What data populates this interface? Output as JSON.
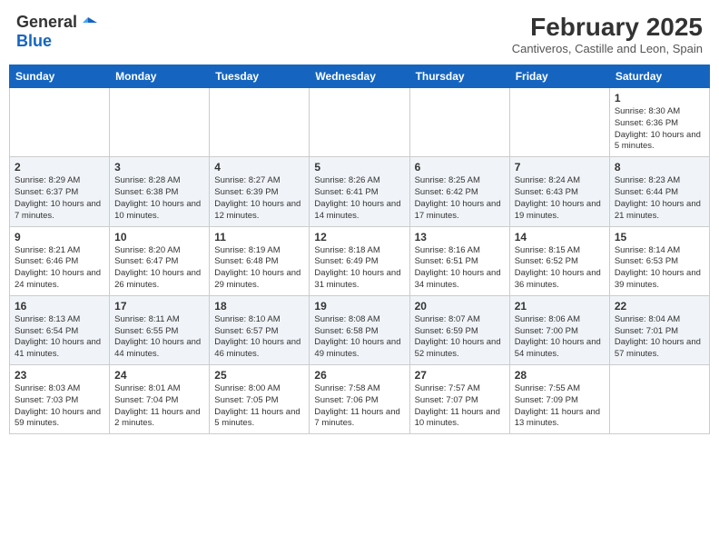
{
  "header": {
    "logo_general": "General",
    "logo_blue": "Blue",
    "month_title": "February 2025",
    "subtitle": "Cantiveros, Castille and Leon, Spain"
  },
  "columns": [
    "Sunday",
    "Monday",
    "Tuesday",
    "Wednesday",
    "Thursday",
    "Friday",
    "Saturday"
  ],
  "weeks": [
    [
      {
        "day": "",
        "info": ""
      },
      {
        "day": "",
        "info": ""
      },
      {
        "day": "",
        "info": ""
      },
      {
        "day": "",
        "info": ""
      },
      {
        "day": "",
        "info": ""
      },
      {
        "day": "",
        "info": ""
      },
      {
        "day": "1",
        "info": "Sunrise: 8:30 AM\nSunset: 6:36 PM\nDaylight: 10 hours and 5 minutes."
      }
    ],
    [
      {
        "day": "2",
        "info": "Sunrise: 8:29 AM\nSunset: 6:37 PM\nDaylight: 10 hours and 7 minutes."
      },
      {
        "day": "3",
        "info": "Sunrise: 8:28 AM\nSunset: 6:38 PM\nDaylight: 10 hours and 10 minutes."
      },
      {
        "day": "4",
        "info": "Sunrise: 8:27 AM\nSunset: 6:39 PM\nDaylight: 10 hours and 12 minutes."
      },
      {
        "day": "5",
        "info": "Sunrise: 8:26 AM\nSunset: 6:41 PM\nDaylight: 10 hours and 14 minutes."
      },
      {
        "day": "6",
        "info": "Sunrise: 8:25 AM\nSunset: 6:42 PM\nDaylight: 10 hours and 17 minutes."
      },
      {
        "day": "7",
        "info": "Sunrise: 8:24 AM\nSunset: 6:43 PM\nDaylight: 10 hours and 19 minutes."
      },
      {
        "day": "8",
        "info": "Sunrise: 8:23 AM\nSunset: 6:44 PM\nDaylight: 10 hours and 21 minutes."
      }
    ],
    [
      {
        "day": "9",
        "info": "Sunrise: 8:21 AM\nSunset: 6:46 PM\nDaylight: 10 hours and 24 minutes."
      },
      {
        "day": "10",
        "info": "Sunrise: 8:20 AM\nSunset: 6:47 PM\nDaylight: 10 hours and 26 minutes."
      },
      {
        "day": "11",
        "info": "Sunrise: 8:19 AM\nSunset: 6:48 PM\nDaylight: 10 hours and 29 minutes."
      },
      {
        "day": "12",
        "info": "Sunrise: 8:18 AM\nSunset: 6:49 PM\nDaylight: 10 hours and 31 minutes."
      },
      {
        "day": "13",
        "info": "Sunrise: 8:16 AM\nSunset: 6:51 PM\nDaylight: 10 hours and 34 minutes."
      },
      {
        "day": "14",
        "info": "Sunrise: 8:15 AM\nSunset: 6:52 PM\nDaylight: 10 hours and 36 minutes."
      },
      {
        "day": "15",
        "info": "Sunrise: 8:14 AM\nSunset: 6:53 PM\nDaylight: 10 hours and 39 minutes."
      }
    ],
    [
      {
        "day": "16",
        "info": "Sunrise: 8:13 AM\nSunset: 6:54 PM\nDaylight: 10 hours and 41 minutes."
      },
      {
        "day": "17",
        "info": "Sunrise: 8:11 AM\nSunset: 6:55 PM\nDaylight: 10 hours and 44 minutes."
      },
      {
        "day": "18",
        "info": "Sunrise: 8:10 AM\nSunset: 6:57 PM\nDaylight: 10 hours and 46 minutes."
      },
      {
        "day": "19",
        "info": "Sunrise: 8:08 AM\nSunset: 6:58 PM\nDaylight: 10 hours and 49 minutes."
      },
      {
        "day": "20",
        "info": "Sunrise: 8:07 AM\nSunset: 6:59 PM\nDaylight: 10 hours and 52 minutes."
      },
      {
        "day": "21",
        "info": "Sunrise: 8:06 AM\nSunset: 7:00 PM\nDaylight: 10 hours and 54 minutes."
      },
      {
        "day": "22",
        "info": "Sunrise: 8:04 AM\nSunset: 7:01 PM\nDaylight: 10 hours and 57 minutes."
      }
    ],
    [
      {
        "day": "23",
        "info": "Sunrise: 8:03 AM\nSunset: 7:03 PM\nDaylight: 10 hours and 59 minutes."
      },
      {
        "day": "24",
        "info": "Sunrise: 8:01 AM\nSunset: 7:04 PM\nDaylight: 11 hours and 2 minutes."
      },
      {
        "day": "25",
        "info": "Sunrise: 8:00 AM\nSunset: 7:05 PM\nDaylight: 11 hours and 5 minutes."
      },
      {
        "day": "26",
        "info": "Sunrise: 7:58 AM\nSunset: 7:06 PM\nDaylight: 11 hours and 7 minutes."
      },
      {
        "day": "27",
        "info": "Sunrise: 7:57 AM\nSunset: 7:07 PM\nDaylight: 11 hours and 10 minutes."
      },
      {
        "day": "28",
        "info": "Sunrise: 7:55 AM\nSunset: 7:09 PM\nDaylight: 11 hours and 13 minutes."
      },
      {
        "day": "",
        "info": ""
      }
    ]
  ]
}
